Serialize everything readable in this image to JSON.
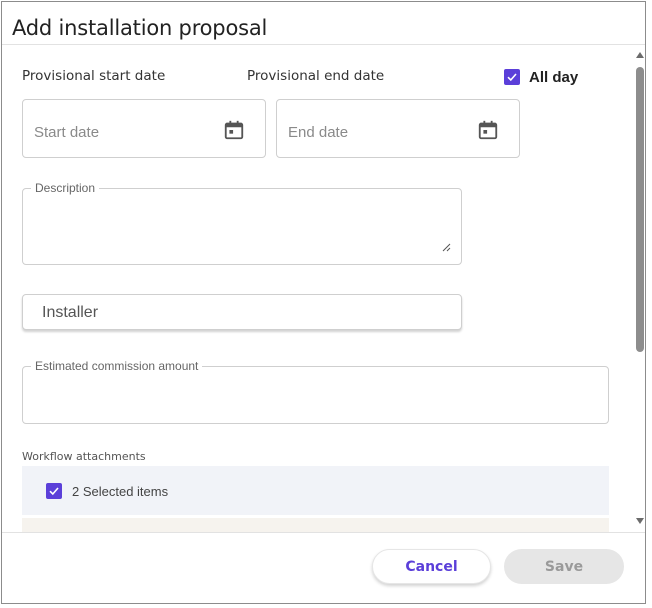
{
  "dialog": {
    "title": "Add installation proposal"
  },
  "dates": {
    "start_label": "Provisional start date",
    "end_label": "Provisional end date",
    "all_day_label": "All day",
    "all_day_checked": true,
    "start_placeholder": "Start date",
    "end_placeholder": "End date",
    "icon": "calendar-icon"
  },
  "description": {
    "label": "Description",
    "value": ""
  },
  "installer": {
    "placeholder": "Installer"
  },
  "commission": {
    "label": "Estimated commission amount",
    "value": ""
  },
  "attachments": {
    "section_label": "Workflow attachments",
    "selected_text": "2 Selected items",
    "selected_checked": true
  },
  "footer": {
    "cancel_label": "Cancel",
    "save_label": "Save"
  },
  "colors": {
    "accent": "#5b3fd9",
    "disabled_bg": "#e6e6e6",
    "disabled_text": "#9a9a9a",
    "attachment_row_bg": "#f1f3f8"
  }
}
